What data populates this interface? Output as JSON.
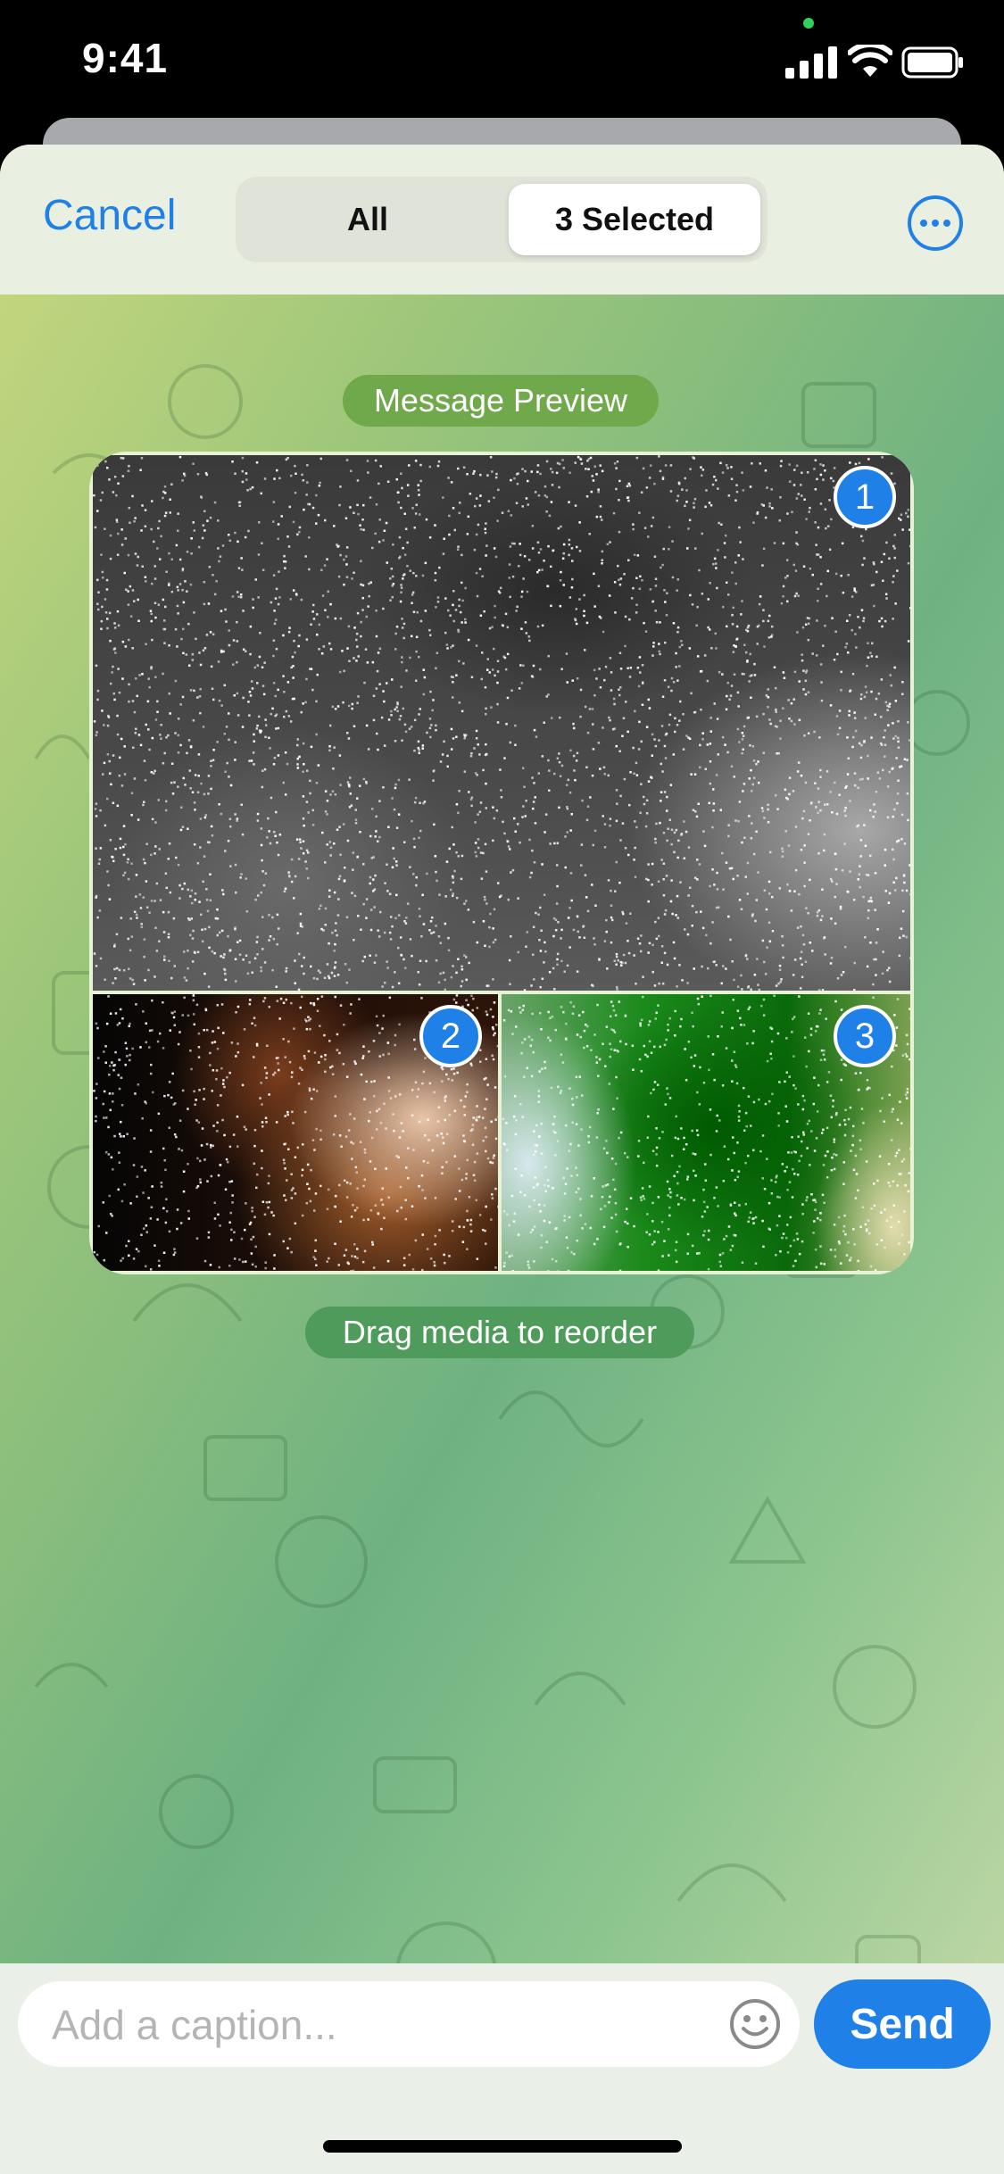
{
  "status_bar": {
    "time": "9:41"
  },
  "header": {
    "cancel_label": "Cancel",
    "segments": {
      "all_label": "All",
      "selected_label": "3 Selected"
    },
    "more_icon": "ellipsis-circle-icon"
  },
  "preview": {
    "title": "Message Preview",
    "hint": "Drag media to reorder",
    "media": [
      {
        "badge": "1"
      },
      {
        "badge": "2"
      },
      {
        "badge": "3"
      }
    ]
  },
  "composer": {
    "caption_placeholder": "Add a caption...",
    "emoji_icon": "smiley-icon",
    "send_label": "Send"
  },
  "colors": {
    "accent": "#1f80e8",
    "pill_preview": "#6fa94c",
    "pill_drag": "#4f9b5c"
  }
}
